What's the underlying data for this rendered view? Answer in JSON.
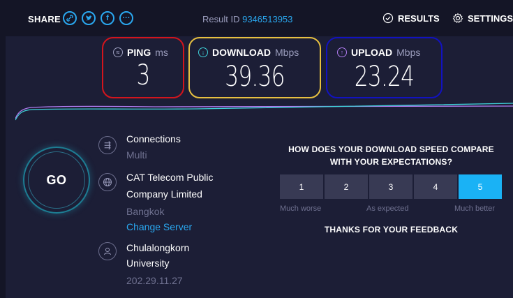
{
  "topbar": {
    "share_label": "SHARE",
    "share_icons": [
      "link-icon",
      "twitter-icon",
      "facebook-icon",
      "more-icon"
    ],
    "result_id_label": "Result ID",
    "result_id": "9346513953",
    "results_label": "RESULTS",
    "settings_label": "SETTINGS"
  },
  "metrics": {
    "ping": {
      "label": "PING",
      "unit": "ms",
      "value": "3",
      "border_color": "#d3151d"
    },
    "download": {
      "label": "DOWNLOAD",
      "unit": "Mbps",
      "value": "39.36",
      "border_color": "#e7c040"
    },
    "upload": {
      "label": "UPLOAD",
      "unit": "Mbps",
      "value": "23.24",
      "border_color": "#1212c0"
    }
  },
  "go_button": {
    "label": "GO"
  },
  "connections": {
    "title": "Connections",
    "value": "Multi"
  },
  "server": {
    "name_line1": "CAT Telecom Public",
    "name_line2": "Company Limited",
    "location": "Bangkok",
    "change_label": "Change Server"
  },
  "provider": {
    "name_line1": "Chulalongkorn",
    "name_line2": "University",
    "ip": "202.29.11.27"
  },
  "feedback": {
    "question_line1": "HOW DOES YOUR DOWNLOAD SPEED COMPARE",
    "question_line2": "WITH YOUR EXPECTATIONS?",
    "ratings": [
      "1",
      "2",
      "3",
      "4",
      "5"
    ],
    "selected_rating": "5",
    "label_low": "Much worse",
    "label_mid": "As expected",
    "label_high": "Much better",
    "thanks": "THANKS FOR YOUR FEEDBACK"
  },
  "colors": {
    "accent": "#2aa8f0",
    "download_line": "#b07cf0",
    "upload_line": "#3fd0d8",
    "selected_rating": "#1ab2f5"
  }
}
